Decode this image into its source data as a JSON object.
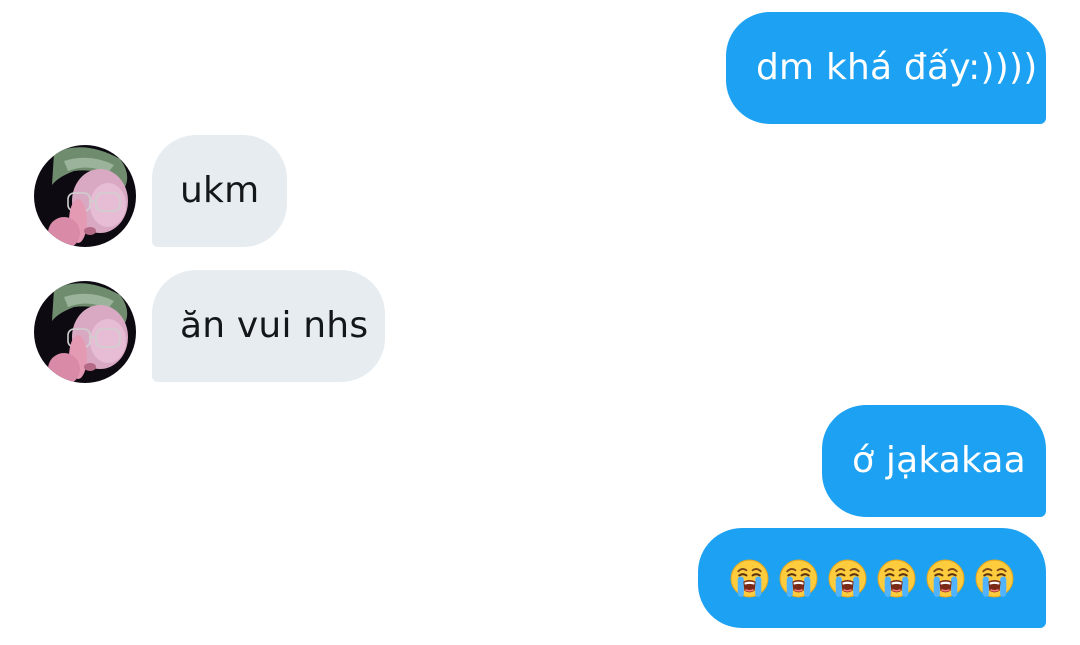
{
  "conversation": {
    "messages": [
      {
        "direction": "outgoing",
        "text": "dm khá đấy:))))"
      },
      {
        "direction": "incoming",
        "text": "ukm"
      },
      {
        "direction": "incoming",
        "text": "ăn vui nhs"
      },
      {
        "direction": "outgoing",
        "text": "ớ jạkakaa"
      },
      {
        "direction": "outgoing",
        "emoji_icon": "loudly-crying-face-icon",
        "emoji_count": 6
      }
    ]
  },
  "colors": {
    "outgoing_bubble": "#1da1f2",
    "incoming_bubble": "#e6ecf0",
    "outgoing_text": "#ffffff",
    "incoming_text": "#14171a"
  }
}
